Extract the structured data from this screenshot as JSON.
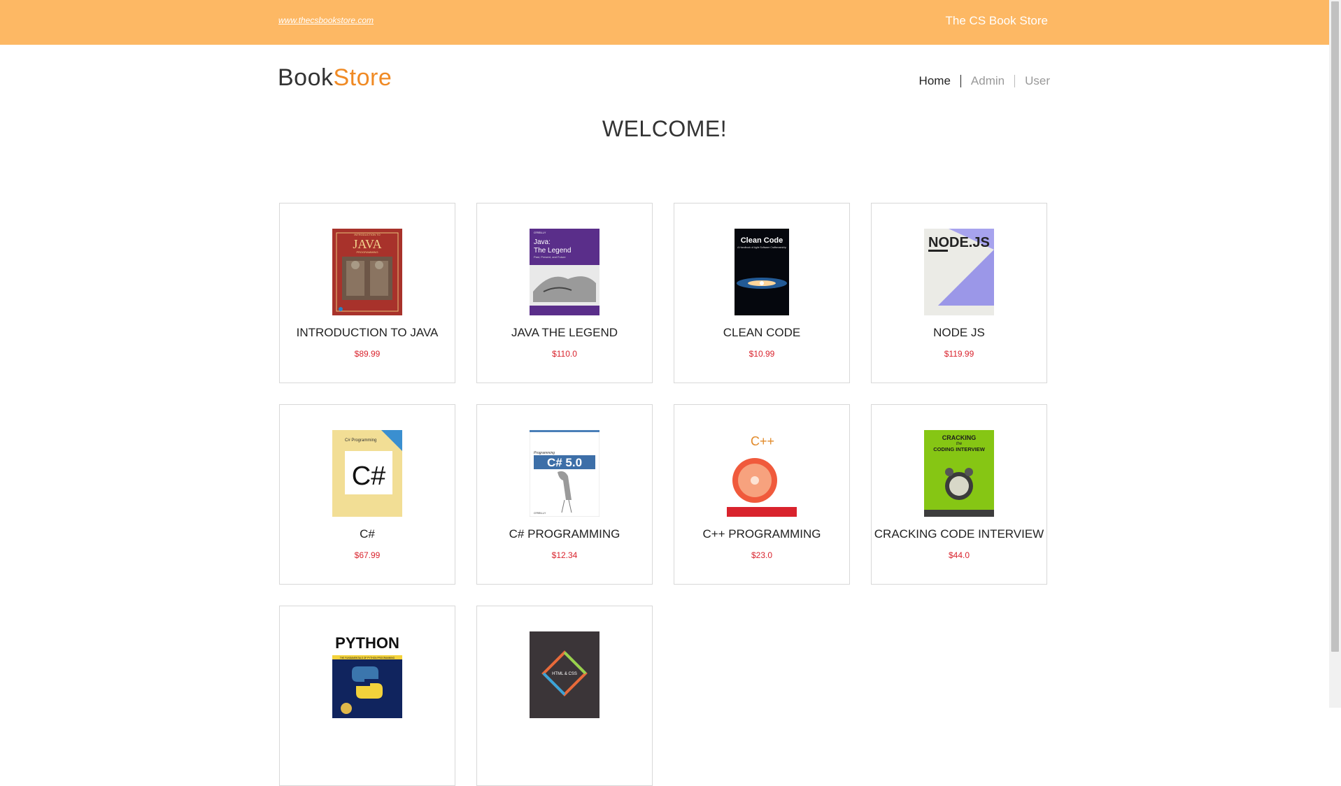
{
  "topbar": {
    "url": "www.thecsbookstore.com",
    "store_name": "The CS Book Store"
  },
  "logo": {
    "part1": "Book",
    "part2": "Store"
  },
  "nav": {
    "home": "Home",
    "admin": "Admin",
    "user": "User"
  },
  "welcome": "WELCOME!",
  "books": [
    {
      "title": "INTRODUCTION TO JAVA",
      "price": "$89.99"
    },
    {
      "title": "JAVA THE LEGEND",
      "price": "$110.0"
    },
    {
      "title": "CLEAN CODE",
      "price": "$10.99"
    },
    {
      "title": "NODE JS",
      "price": "$119.99"
    },
    {
      "title": "C#",
      "price": "$67.99"
    },
    {
      "title": "C# PROGRAMMING",
      "price": "$12.34"
    },
    {
      "title": "C++ PROGRAMMING",
      "price": "$23.0"
    },
    {
      "title": "CRACKING CODE INTERVIEW",
      "price": "$44.0"
    },
    {
      "title": "",
      "price": ""
    },
    {
      "title": "",
      "price": ""
    }
  ],
  "covers": {
    "java_intro": {
      "small": "INTRODUCTION TO",
      "big": "JAVA",
      "sub": "PROGRAMMING"
    },
    "java_legend": {
      "brand": "O'REILLY",
      "line1": "Java:",
      "line2": "The Legend",
      "sub": "Past, Present, and Future"
    },
    "clean_code": {
      "line1": "Clean Code",
      "sub": "A Handbook of Agile Software Craftsmanship"
    },
    "nodejs": {
      "big": "NODE.JS"
    },
    "csharp": {
      "top": "C# Programming",
      "big": "C#"
    },
    "csharp5": {
      "top": "Programming",
      "big": "C# 5.0",
      "brand": "O'REILLY"
    },
    "cpp": {
      "big": "C++"
    },
    "cracking": {
      "line1": "CRACKING",
      "line2": "the",
      "line3": "CODING INTERVIEW"
    },
    "python": {
      "big": "PYTHON",
      "sub": "THE FUNDAMENTALS OF PYTHON PROGRAMMING"
    },
    "htmlcss": {
      "big": "HTML & CSS"
    }
  }
}
